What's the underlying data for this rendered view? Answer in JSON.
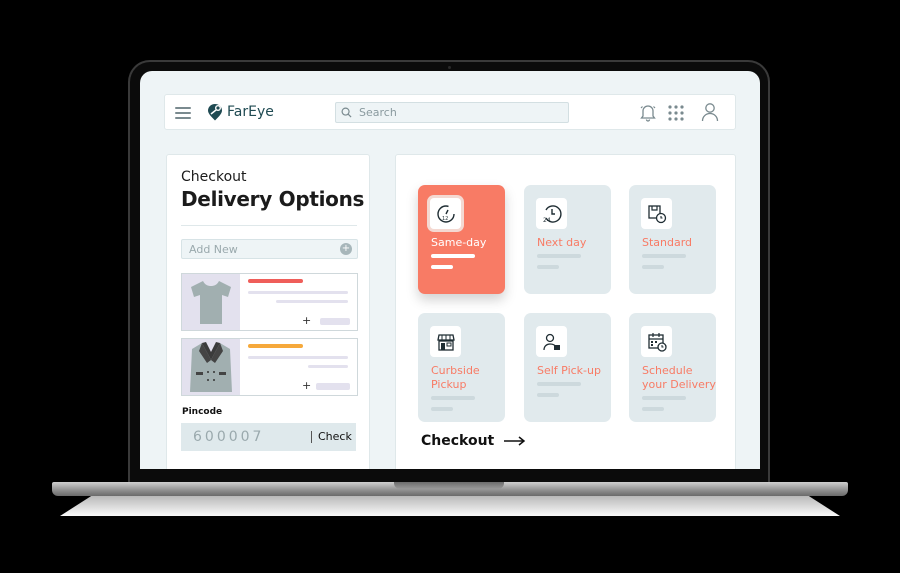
{
  "app": {
    "brand": "FarEye",
    "search_placeholder": "Search",
    "icons": {
      "menu": "hamburger-menu-icon",
      "logo": "fareye-logo-icon",
      "search": "search-icon",
      "notifications": "bell-icon",
      "apps": "grid-icon",
      "profile": "user-icon"
    }
  },
  "cart": {
    "subtitle": "Checkout",
    "title": "Delivery Options",
    "add_new_placeholder": "Add New",
    "products": [
      {
        "name": "t-shirt",
        "accent": "#ef5e5a",
        "qty_button": "+"
      },
      {
        "name": "blazer",
        "accent": "#f6a93b",
        "qty_button": "+"
      }
    ],
    "pincode_label": "Pincode",
    "pincode_value": "600007",
    "check_label": "Check"
  },
  "delivery": {
    "options": [
      {
        "label": "Same-day",
        "icon": "speedometer-icon",
        "selected": true
      },
      {
        "label": "Next day",
        "icon": "24-hour-clock-icon",
        "selected": false
      },
      {
        "label": "Standard",
        "icon": "package-clock-icon",
        "selected": false
      },
      {
        "label": "Curbside Pickup",
        "line1": "Curbside",
        "line2": "Pickup",
        "icon": "storefront-icon",
        "selected": false
      },
      {
        "label": "Self Pick-up",
        "icon": "person-package-icon",
        "selected": false
      },
      {
        "label": "Schedule your Delivery",
        "line1": "Schedule",
        "line2": "your Delivery",
        "icon": "calendar-clock-icon",
        "selected": false
      }
    ],
    "checkout_label": "Checkout",
    "accent_color": "#f87b65"
  }
}
